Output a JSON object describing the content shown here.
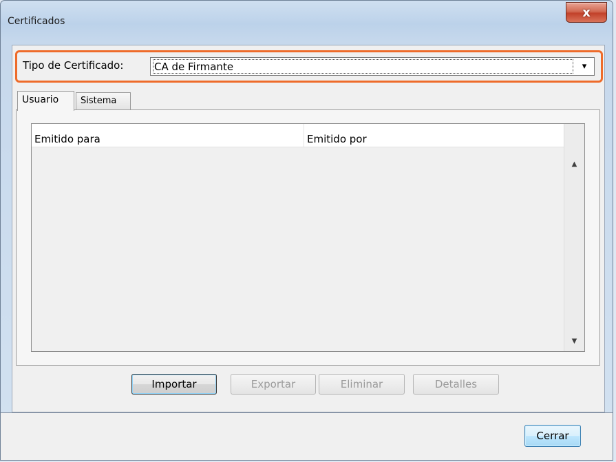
{
  "window": {
    "title": "Certificados",
    "close_label": "x"
  },
  "certificate_type": {
    "label": "Tipo de Certificado:",
    "selected_value": "CA de Firmante",
    "dropdown_arrow": "▾"
  },
  "tabs": [
    {
      "label": "Usuario",
      "active": true
    },
    {
      "label": "Sistema",
      "active": false
    }
  ],
  "table": {
    "columns": [
      "Emitido para",
      "Emitido por"
    ],
    "rows": []
  },
  "scrollbar": {
    "up_arrow": "▲",
    "down_arrow": "▼"
  },
  "actions": {
    "import_label": "Importar",
    "export_label": "Exportar",
    "delete_label": "Eliminar",
    "details_label": "Detalles"
  },
  "footer": {
    "close_label": "Cerrar"
  },
  "colors": {
    "highlight_border": "#ee6b2a",
    "close_button": "#c2412a",
    "active_button": "#a7d9f5"
  }
}
